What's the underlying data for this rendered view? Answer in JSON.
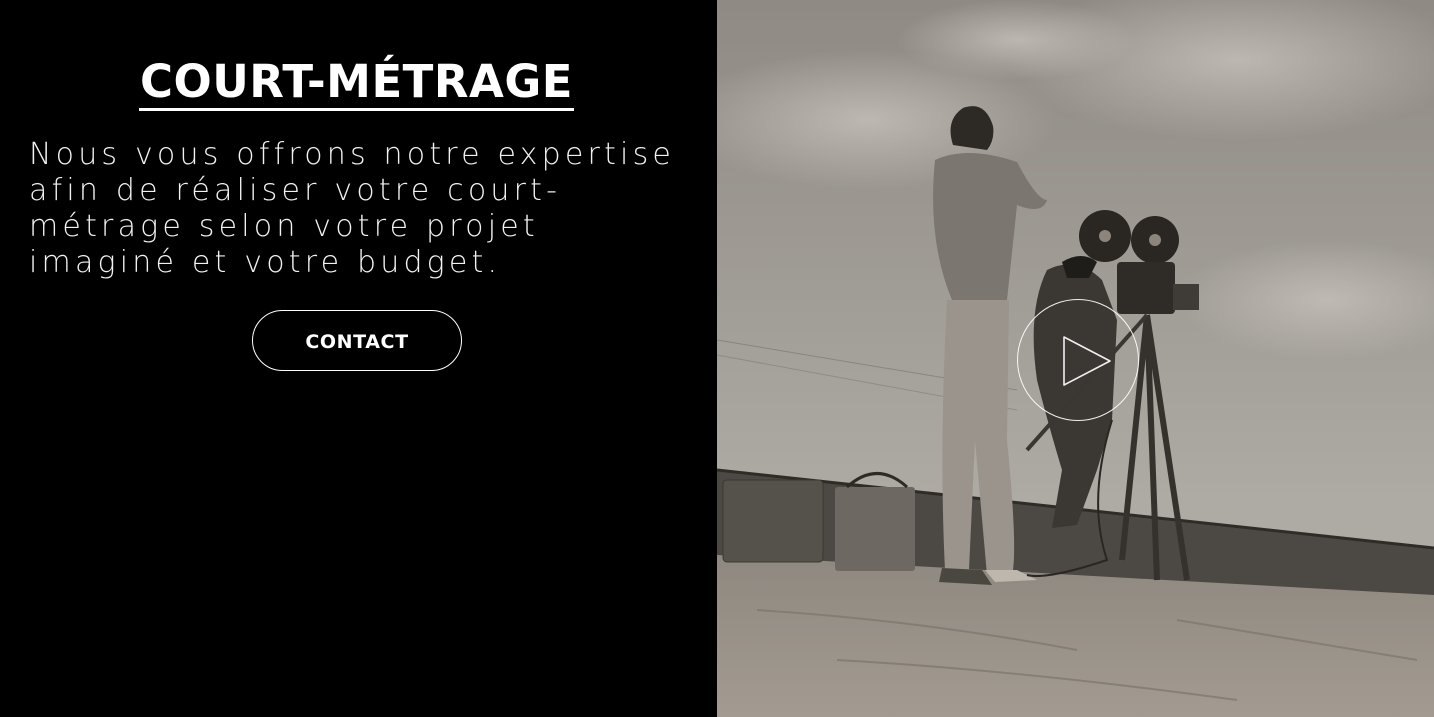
{
  "hero": {
    "title": "COURT-MÉTRAGE",
    "description_lines": [
      "Nous vous offrons notre expertise",
      "afin de réaliser votre court-",
      "métrage selon votre projet",
      "imaginé et votre budget."
    ],
    "contact_label": "CONTACT"
  },
  "media": {
    "photo_subject": "vintage sepia photo of two men operating a film camera on a tripod by a railway embankment",
    "play_icon": "play-icon"
  },
  "colors": {
    "background": "#000000",
    "text": "#ffffff",
    "photo_tone": "#8e8a84"
  }
}
